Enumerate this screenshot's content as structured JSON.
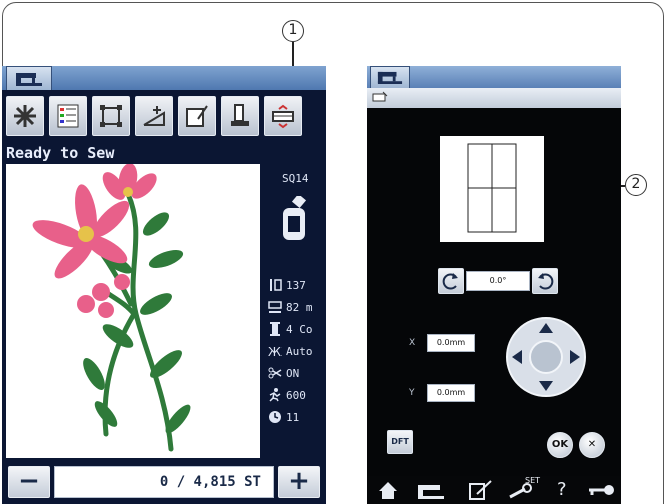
{
  "callouts": {
    "one": "1",
    "two": "2"
  },
  "left_screen": {
    "status_title": "Ready to Sew",
    "toolbar_icons": [
      "flower-settings-icon",
      "color-list-icon",
      "trace-icon",
      "tension-icon",
      "template-icon",
      "thread-cutter-icon",
      "layout-icon"
    ],
    "hoop_code": "SQ14",
    "info": [
      {
        "icon": "height-icon",
        "value": "137"
      },
      {
        "icon": "width-icon",
        "value": "82 m"
      },
      {
        "icon": "colors-icon",
        "value": "4 Co"
      },
      {
        "icon": "auto-icon",
        "value": "Auto"
      },
      {
        "icon": "trim-icon",
        "value": "ON"
      },
      {
        "icon": "speed-icon",
        "value": "600"
      },
      {
        "icon": "time-icon",
        "value": "11"
      }
    ],
    "minus_label": "−",
    "plus_label": "+",
    "stitch_count": "0 / 4,815 ST"
  },
  "right_screen": {
    "rotation_value": "0.0°",
    "x_label": "X",
    "y_label": "Y",
    "x_value": "0.0mm",
    "y_value": "0.0mm",
    "default_label": "DFT",
    "ok_label": "OK",
    "cancel_label": "✕",
    "home_bar": {
      "set_label": "SET",
      "help_label": "?"
    }
  },
  "colors": {
    "screen_bg": "#0b1633",
    "accent": "#4f78b0",
    "flower_pink": "#e8608a",
    "leaf_green": "#2f7a3a"
  }
}
